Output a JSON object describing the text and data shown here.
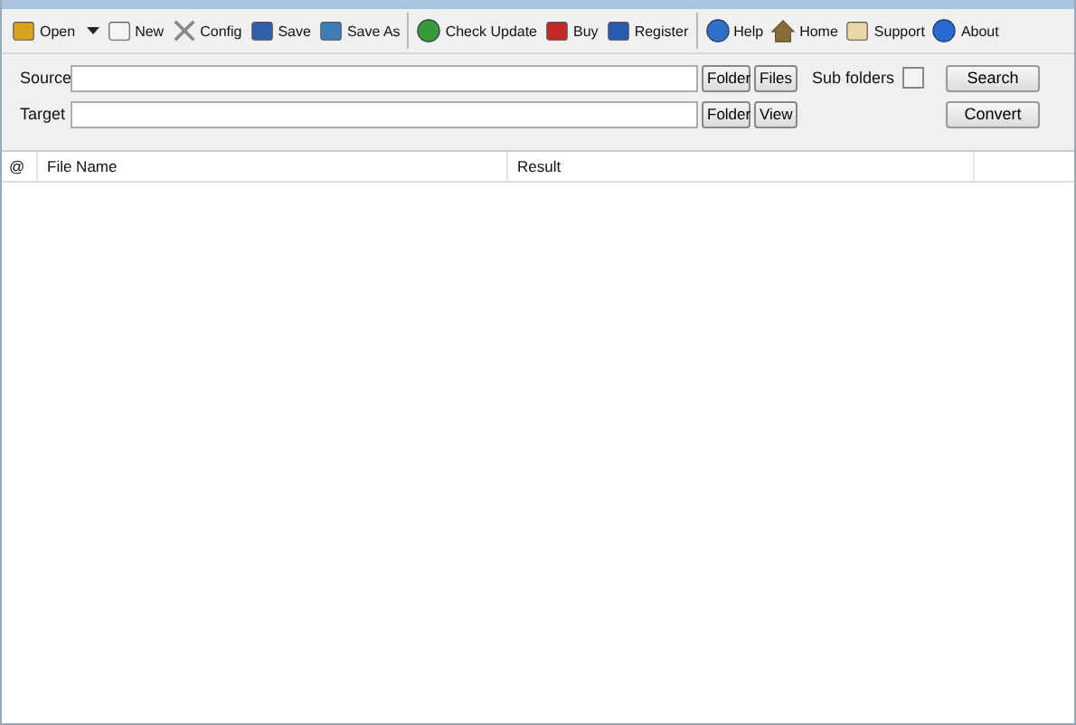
{
  "toolbar_groups": [
    [
      {
        "label": "Open",
        "dropdown": true
      },
      {
        "label": "New"
      },
      {
        "label": "Config"
      },
      {
        "label": "Save"
      },
      {
        "label": "Save As"
      }
    ],
    [
      {
        "label": "Check Update"
      },
      {
        "label": "Buy"
      },
      {
        "label": "Register"
      }
    ],
    [
      {
        "label": "Help"
      },
      {
        "label": "Home"
      },
      {
        "label": "Support"
      },
      {
        "label": "About"
      }
    ]
  ],
  "source": {
    "label": "Source",
    "buttons": [
      "Folder",
      "Files"
    ]
  },
  "target": {
    "label": "Target",
    "buttons": [
      "Folder",
      "View"
    ]
  },
  "sub_folders": {
    "label": "Sub folders",
    "checked": false
  },
  "actions": [
    "Search",
    "Convert"
  ],
  "table": {
    "columns": [
      "@",
      "File Name",
      "Result"
    ]
  }
}
